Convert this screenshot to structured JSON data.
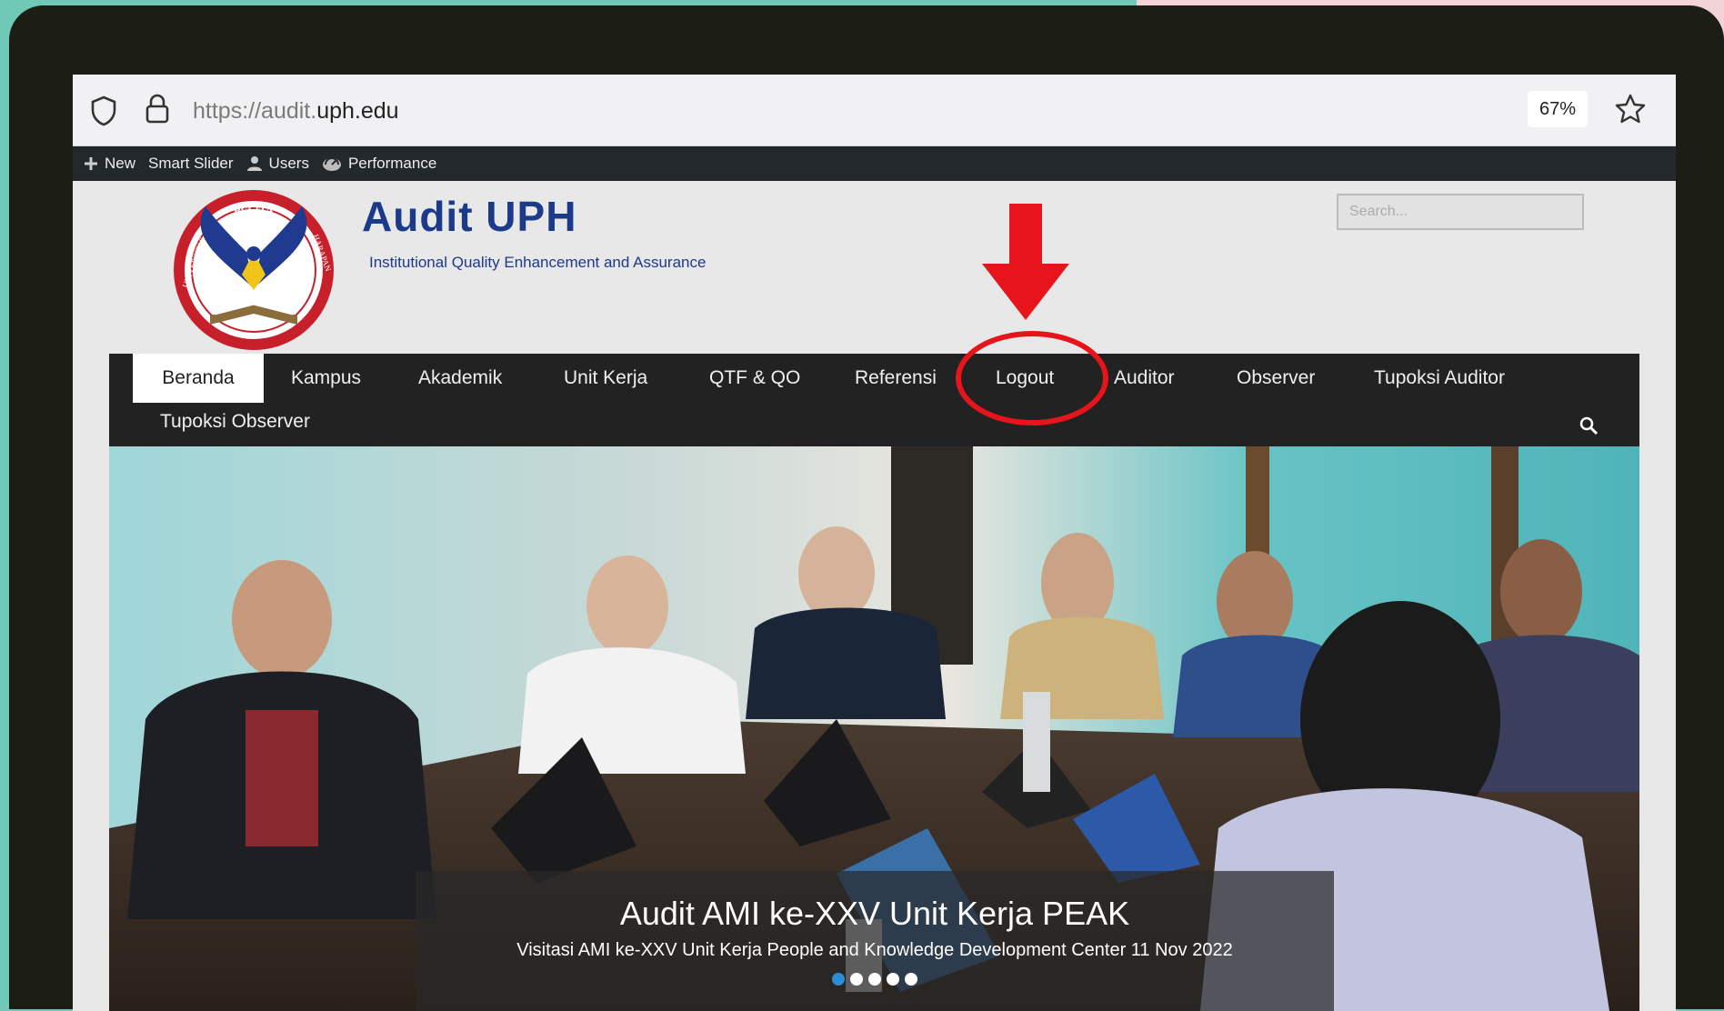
{
  "browser": {
    "url_prefix": "https://audit.",
    "url_domain": "uph.edu",
    "zoom": "67%"
  },
  "admin_bar": {
    "items": [
      {
        "label": "New",
        "icon": "plus-icon"
      },
      {
        "label": "Smart Slider",
        "icon": ""
      },
      {
        "label": "Users",
        "icon": "user-icon"
      },
      {
        "label": "Performance",
        "icon": "performance-icon"
      }
    ]
  },
  "header": {
    "title": "Audit UPH",
    "tagline": "Institutional Quality Enhancement and Assurance",
    "search_placeholder": "Search...",
    "logo_top_text": "PELITA",
    "logo_left_text": "UNIVERSITAS",
    "logo_right_text": "HARAPAN"
  },
  "nav": {
    "items": [
      {
        "label": "Beranda",
        "active": true
      },
      {
        "label": "Kampus"
      },
      {
        "label": "Akademik"
      },
      {
        "label": "Unit Kerja"
      },
      {
        "label": "QTF & QO"
      },
      {
        "label": "Referensi"
      },
      {
        "label": "Logout"
      },
      {
        "label": "Auditor"
      },
      {
        "label": "Observer"
      },
      {
        "label": "Tupoksi Auditor"
      },
      {
        "label": "Tupoksi Observer"
      }
    ]
  },
  "slider": {
    "title": "Audit AMI ke-XXV Unit Kerja PEAK",
    "subtitle": "Visitasi AMI ke-XXV Unit Kerja People and Knowledge Development Center 11 Nov 2022",
    "slide_count": 5,
    "active_slide": 1
  },
  "annotation": {
    "highlight_target": "Logout",
    "color": "#e8141b"
  }
}
